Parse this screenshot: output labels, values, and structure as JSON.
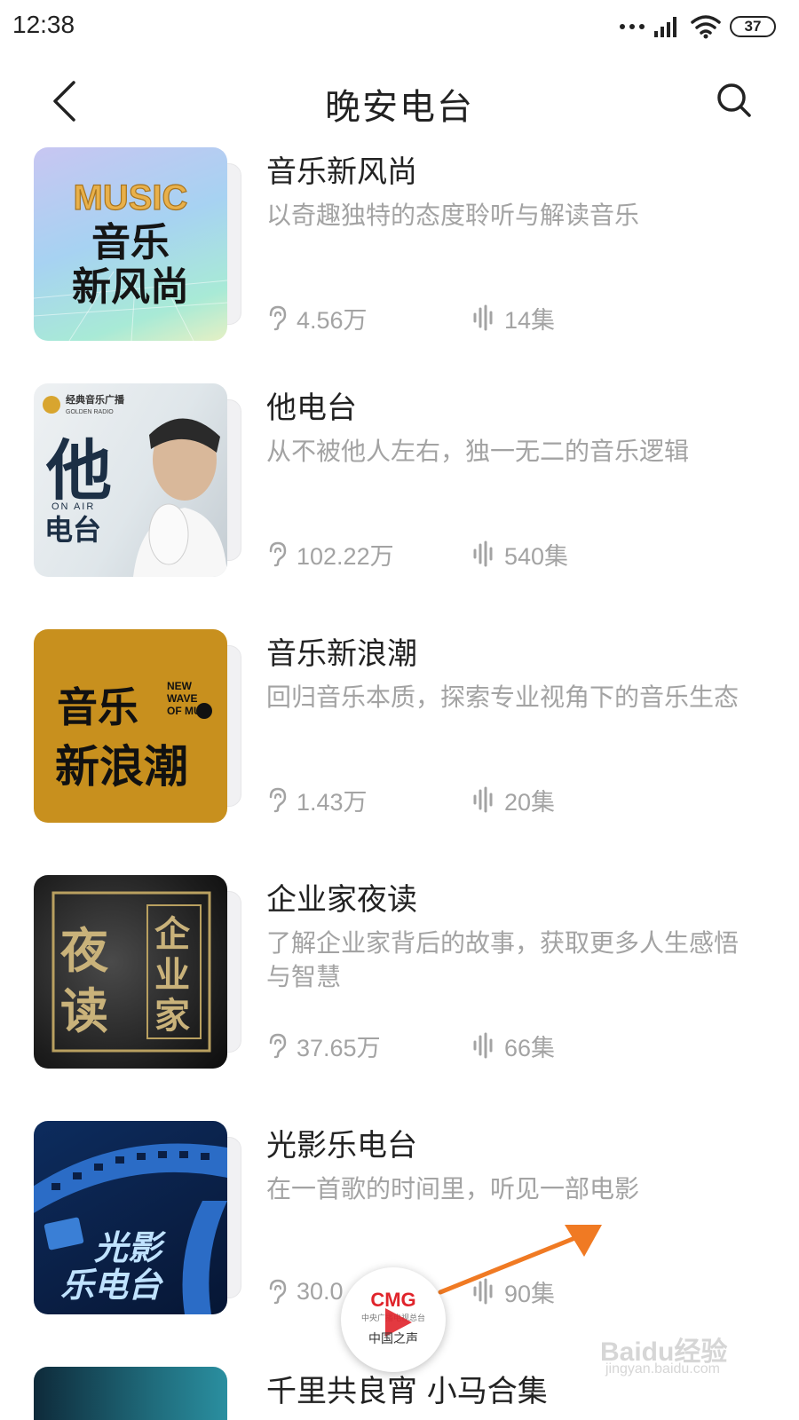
{
  "status": {
    "time": "12:38",
    "battery": "37",
    "icons": [
      "dots-icon",
      "signal-icon",
      "wifi-icon",
      "battery-icon"
    ]
  },
  "header": {
    "title": "晚安电台",
    "back_icon": "chevron-left-icon",
    "search_icon": "search-icon"
  },
  "items": [
    {
      "title": "音乐新风尚",
      "desc": "以奇趣独特的态度聆听与解读音乐",
      "plays": "4.56万",
      "episodes": "14集",
      "cover": {
        "word": "MUSIC",
        "line1": "音乐",
        "line2": "新风尚"
      }
    },
    {
      "title": "他电台",
      "desc": "从不被他人左右，独一无二的音乐逻辑",
      "plays": "102.22万",
      "episodes": "540集",
      "cover": {
        "brand": "经典音乐广播",
        "brand_en": "GOLDEN RADIO",
        "big": "他",
        "on_air": "ON AIR",
        "sub": "电台"
      }
    },
    {
      "title": "音乐新浪潮",
      "desc": "回归音乐本质，探索专业视角下的音乐生态",
      "plays": "1.43万",
      "episodes": "20集",
      "cover": {
        "line1": "音乐",
        "line2": "新浪潮",
        "en1": "NEW",
        "en2": "WAVE",
        "en3": "OF MU"
      }
    },
    {
      "title": "企业家夜读",
      "desc": "了解企业家背后的故事，获取更多人生感悟与智慧",
      "plays": "37.65万",
      "episodes": "66集",
      "cover": {
        "left": "夜读",
        "right": "企业家"
      }
    },
    {
      "title": "光影乐电台",
      "desc": "在一首歌的时间里，听见一部电影",
      "plays": "30.0",
      "episodes": "90集",
      "cover": {
        "line1": "光影",
        "line2": "乐电台"
      }
    },
    {
      "title": "千里共良宵 小马合集"
    }
  ],
  "float_player": {
    "logo": "CMG",
    "sub": "中央广播电视总台",
    "name": "中国之声"
  },
  "watermark": {
    "main": "Baidu经验",
    "sub": "jingyan.baidu.com"
  },
  "colors": {
    "text_primary": "#222222",
    "text_secondary": "#a3a3a3",
    "arrow": "#f07a23",
    "cmg_red": "#e0242b"
  }
}
